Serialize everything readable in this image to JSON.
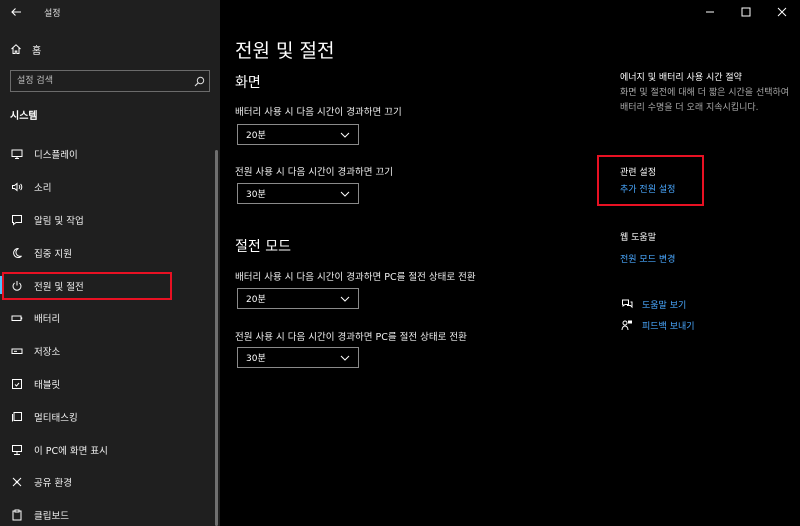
{
  "window": {
    "title": "설정"
  },
  "sidebar": {
    "home_label": "홈",
    "search_placeholder": "설정 검색",
    "section": "시스템",
    "items": [
      {
        "label": "디스플레이",
        "icon": "monitor-icon"
      },
      {
        "label": "소리",
        "icon": "speaker-icon"
      },
      {
        "label": "알림 및 작업",
        "icon": "notification-icon"
      },
      {
        "label": "집중 지원",
        "icon": "moon-icon"
      },
      {
        "label": "전원 및 절전",
        "icon": "power-icon",
        "selected": true
      },
      {
        "label": "배터리",
        "icon": "battery-icon"
      },
      {
        "label": "저장소",
        "icon": "storage-icon"
      },
      {
        "label": "태블릿",
        "icon": "tablet-icon"
      },
      {
        "label": "멀티태스킹",
        "icon": "multitasking-icon"
      },
      {
        "label": "이 PC에 화면 표시",
        "icon": "project-icon"
      },
      {
        "label": "공유 환경",
        "icon": "shared-experiences-icon"
      },
      {
        "label": "클립보드",
        "icon": "clipboard-icon"
      }
    ]
  },
  "main": {
    "title": "전원 및 절전",
    "screen": {
      "heading": "화면",
      "battery_label": "배터리 사용 시 다음 시간이 경과하면 끄기",
      "battery_value": "20분",
      "plugged_label": "전원 사용 시 다음 시간이 경과하면 끄기",
      "plugged_value": "30분"
    },
    "sleep": {
      "heading": "절전 모드",
      "battery_label": "배터리 사용 시 다음 시간이 경과하면 PC를 절전 상태로 전환",
      "battery_value": "20분",
      "plugged_label": "전원 사용 시 다음 시간이 경과하면 PC를 절전 상태로 전환",
      "plugged_value": "30분"
    }
  },
  "right": {
    "energy_title": "에너지 및 배터리 사용 시간 절약",
    "energy_desc": "화면 및 절전에 대해 더 짧은 시간을 선택하여 배터리 수명을 더 오래 지속시킵니다.",
    "related_title": "관련 설정",
    "related_link": "추가 전원 설정",
    "web_help_title": "웹 도움말",
    "web_help_link": "전원 모드 변경",
    "get_help": "도움말 보기",
    "feedback": "피드백 보내기"
  },
  "colors": {
    "accent": "#4cc2ff",
    "link": "#4aa8ff",
    "highlight": "#e81123",
    "sidebar_bg": "#1f1f1f"
  }
}
